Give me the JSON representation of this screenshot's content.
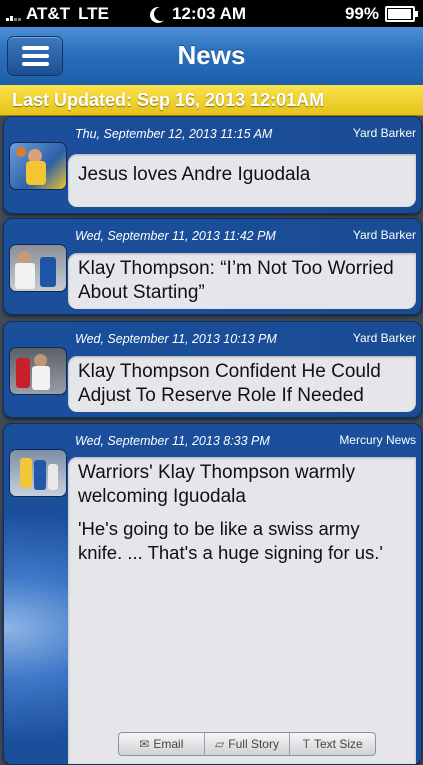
{
  "status": {
    "carrier": "AT&T",
    "network": "LTE",
    "time": "12:03 AM",
    "battery": "99%"
  },
  "nav": {
    "title": "News",
    "menu_icon": "hamburger-icon"
  },
  "updated": {
    "text": "Last Updated: Sep 16, 2013 12:01AM"
  },
  "articles": [
    {
      "date": "Thu, September 12, 2013 11:15 AM",
      "source": "Yard Barker",
      "headline": "Jesus loves Andre Iguodala",
      "summary": ""
    },
    {
      "date": "Wed, September 11, 2013 11:42 PM",
      "source": "Yard Barker",
      "headline": "Klay Thompson: “I’m Not Too Worried About Starting”",
      "summary": ""
    },
    {
      "date": "Wed, September 11, 2013 10:13 PM",
      "source": "Yard Barker",
      "headline": "Klay Thompson Confident He Could Adjust To Reserve Role If Needed",
      "summary": ""
    },
    {
      "date": "Wed, September 11, 2013 8:33 PM",
      "source": "Mercury News",
      "headline": "Warriors' Klay Thompson warmly welcoming Iguodala",
      "summary": "'He's going to be like a swiss army knife. ... That's a huge signing for us.'"
    }
  ],
  "toolbar": {
    "email": "Email",
    "full_story": "Full Story",
    "text_size": "Text Size"
  },
  "colors": {
    "nav_blue": "#2a6fbd",
    "card_blue": "#1b4f9c",
    "updated_yellow": "#f0d22c",
    "bubble": "#e4e6ea"
  }
}
